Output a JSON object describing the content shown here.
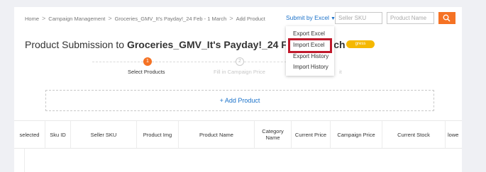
{
  "breadcrumb": {
    "items": [
      "Home",
      "Campaign Management",
      "Groceries_GMV_It's Payday!_24 Feb - 1 March",
      "Add Product"
    ],
    "separator": ">"
  },
  "toolbar": {
    "submit_excel_label": "Submit by Excel",
    "caret": "▼",
    "seller_sku_placeholder": "Seller SKU",
    "product_name_placeholder": "Product Name"
  },
  "page": {
    "title_prefix": "Product Submission to ",
    "title_campaign": "Groceries_GMV_It's Payday!_24 Feb - 1 March",
    "status_badge": "gress"
  },
  "steps": [
    {
      "number": "1",
      "label": "Select Products"
    },
    {
      "number": "2",
      "label": "Fill in Campaign Price"
    },
    {
      "label": "it"
    }
  ],
  "add_product_label": "+ Add Product",
  "table": {
    "columns": [
      "selected",
      "Sku ID",
      "Seller SKU",
      "Product Img",
      "Product Name",
      "Category Name",
      "Current Price",
      "Campaign Price",
      "Current Stock",
      "lowe"
    ]
  },
  "dropdown": {
    "items": [
      "Export Excel",
      "Import Excel",
      "Export History",
      "Import History"
    ],
    "highlighted": "Import Excel"
  },
  "colors": {
    "accent": "#f57224",
    "link": "#1a71c9",
    "highlight": "#c0192b",
    "badge": "#f5b800"
  }
}
